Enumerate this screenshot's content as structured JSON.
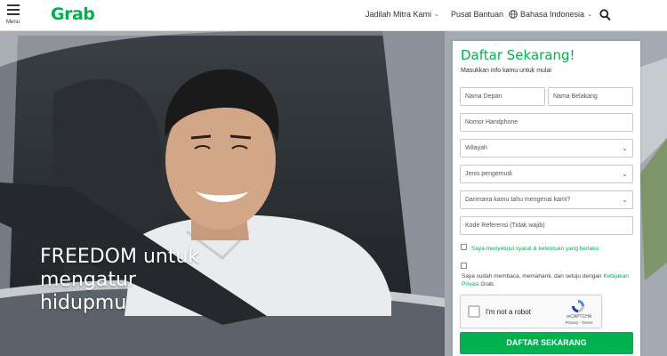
{
  "header": {
    "menu_label": "Menu",
    "logo": "Grab",
    "nav": [
      {
        "label": "Jadilah Mitra Kami",
        "has_dropdown": true
      },
      {
        "label": "Pusat Bantuan",
        "has_dropdown": false
      },
      {
        "label": "Bahasa Indonesia",
        "has_dropdown": true,
        "icon": "globe-icon"
      }
    ],
    "search_icon": "search-icon",
    "accent": "#00b14f"
  },
  "hero": {
    "tagline_lines": [
      "FREEDOM untuk",
      "mengatur",
      "hidupmu"
    ]
  },
  "form": {
    "title": "Daftar Sekarang!",
    "subtitle": "Masukkan info kamu untuk mulai",
    "first_name_placeholder": "Nama Depan",
    "last_name_placeholder": "Nama Belakang",
    "phone_placeholder": "Nomor Handphone",
    "region_select": "Wilayah",
    "driver_type_select": "Jenis pengemudi",
    "source_select": "Darimana kamu tahu mengenai kami?",
    "referral_placeholder": "Kode Referensi (Tidak wajib)",
    "terms_label": "Saya menyetujui syarat & ketentuan yang berlaku",
    "privacy_prefix": "Saya sudah membaca, memahami, dan setuju dengan",
    "privacy_link": "Kebijakan Privasi",
    "privacy_suffix": "Grab.",
    "recaptcha": {
      "label": "I'm not a robot",
      "brand": "reCAPTCHA",
      "links": "Privacy - Terms"
    },
    "submit_label": "DAFTAR SEKARANG"
  }
}
